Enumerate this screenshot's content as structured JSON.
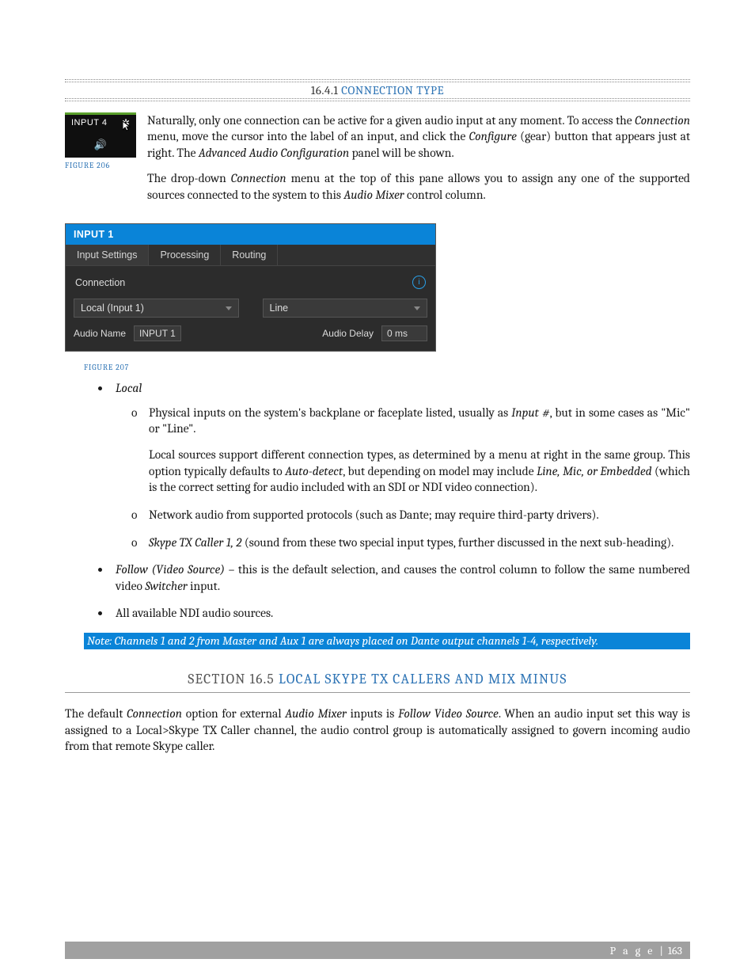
{
  "section_a": {
    "number": "16.4.1",
    "title": "CONNECTION TYPE"
  },
  "fig206": {
    "input_label": "INPUT 4",
    "gear": "✲",
    "speaker": "🔊",
    "caption": "FIGURE 206"
  },
  "para1": {
    "pre": "Naturally, only one connection can be active for a given audio input at any moment. To access the ",
    "w1": "Connection",
    "mid1": " menu, move the cursor into the label of an input, and click the ",
    "w2": "Configure",
    "mid2": " (gear) button that appears just at right. The ",
    "w3": "Advanced Audio Configuration",
    "post": " panel will be shown."
  },
  "para2": {
    "pre": "The drop-down ",
    "w1": "Connection",
    "mid1": " menu at the top of this pane allows you to assign any one of the supported sources connected to the system to this ",
    "w2": "Audio Mixer",
    "post": " control column."
  },
  "panel": {
    "title": "INPUT 1",
    "tab_settings": "Input Settings",
    "tab_processing": "Processing",
    "tab_routing": "Routing",
    "connection_label": "Connection",
    "dd_source": "Local (Input 1)",
    "dd_type": "Line",
    "audio_name_label": "Audio Name",
    "audio_name_value": "INPUT 1",
    "audio_delay_label": "Audio Delay",
    "audio_delay_value": "0 ms"
  },
  "fig207_caption": "FIGURE 207",
  "bullets": {
    "local": "Local",
    "local_sub1_pre": "Physical inputs on the system's backplane or faceplate listed, usually as ",
    "local_sub1_em": "Input #",
    "local_sub1_post": ", but in some cases as \"Mic\" or \"Line\".",
    "local_sub1_p2_pre": "Local sources support different connection types, as determined by a menu at right in the same group. This option typically defaults to ",
    "local_sub1_p2_em1": "Auto-detect",
    "local_sub1_p2_mid": ", but depending on model may include ",
    "local_sub1_p2_em2": "Line, Mic, or Embedded",
    "local_sub1_p2_post": " (which is the correct setting for audio included with an SDI or NDI video connection).",
    "local_sub2": "Network audio from supported protocols (such as Dante; may require third-party drivers).",
    "local_sub3_em": "Skype TX Caller 1, 2",
    "local_sub3_post": " (sound from these two special input types, further discussed in the next sub-heading).",
    "follow_em": "Follow (Video Source)",
    "follow_mid": " – this is the default selection, and causes the control column to follow the same numbered video ",
    "follow_em2": "Switcher",
    "follow_post": " input.",
    "ndi": "All available NDI audio sources."
  },
  "note": "Note: Channels 1 and 2 from Master and Aux 1 are always placed on Dante output channels 1-4, respectively.",
  "section_b": {
    "pre": "SECTION 16.5 ",
    "title": "LOCAL SKYPE TX CALLERS AND MIX MINUS"
  },
  "para3": {
    "pre": "The default ",
    "w1": "Connection",
    "mid1": " option for external ",
    "w2": "Audio Mixer",
    "mid2": " inputs is ",
    "w3": "Follow Video Source",
    "post": ".  When an audio input set this way is assigned to a Local>Skype TX Caller channel, the audio control group is automatically assigned to govern incoming audio from that remote Skype caller."
  },
  "footer": {
    "label": "P a g e",
    "sep": " | ",
    "num": "163"
  }
}
